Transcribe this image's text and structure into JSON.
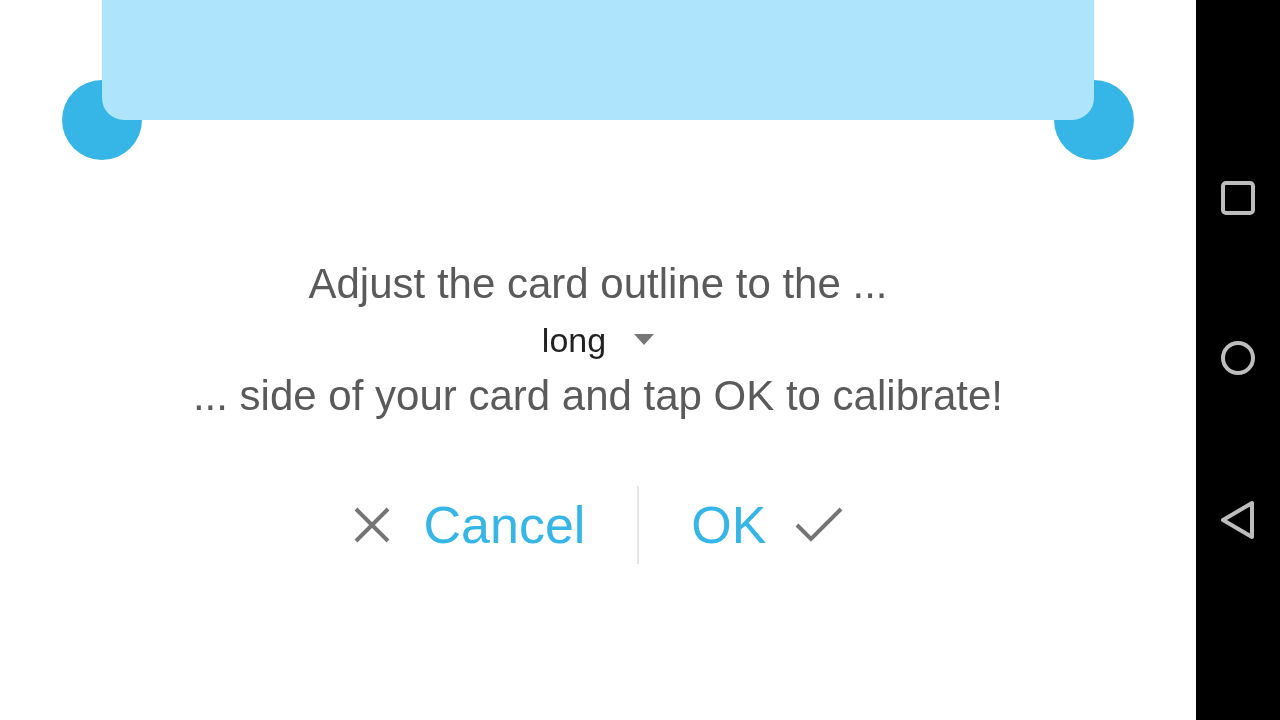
{
  "instructions": {
    "before": "Adjust the card outline to the ...",
    "side": "long",
    "after": "... side of your card and tap OK to calibrate!"
  },
  "buttons": [
    {
      "kind": "cancel",
      "label": "Cancel"
    },
    {
      "kind": "ok",
      "label": "OK"
    }
  ]
}
